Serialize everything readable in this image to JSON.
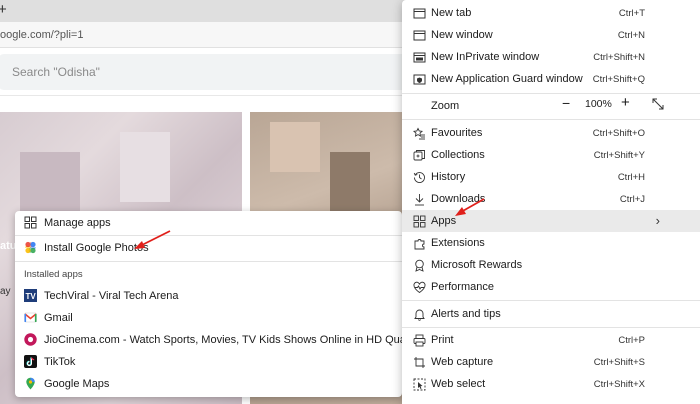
{
  "browser": {
    "new_tab_glyph": "+",
    "url": "oogle.com/?pli=1",
    "more_label": "···"
  },
  "page": {
    "search_placeholder": "Search \"Odisha\"",
    "bg_text_1": "atu",
    "bg_text_2": "ay"
  },
  "apps_submenu": {
    "manage_apps": "Manage apps",
    "install_app": "Install Google Photos",
    "installed_heading": "Installed apps",
    "installed": [
      {
        "label": "TechViral - Viral Tech Arena",
        "icon": "techviral-icon"
      },
      {
        "label": "Gmail",
        "icon": "gmail-icon"
      },
      {
        "label": "JioCinema.com - Watch Sports, Movies, TV  Kids Shows Online in HD Quality",
        "icon": "jiocinema-icon"
      },
      {
        "label": "TikTok",
        "icon": "tiktok-icon"
      },
      {
        "label": "Google Maps",
        "icon": "google-maps-icon"
      }
    ]
  },
  "menu": {
    "new_tab": {
      "label": "New tab",
      "shortcut": "Ctrl+T"
    },
    "new_window": {
      "label": "New window",
      "shortcut": "Ctrl+N"
    },
    "new_inprivate": {
      "label": "New InPrivate window",
      "shortcut": "Ctrl+Shift+N"
    },
    "new_app_guard": {
      "label": "New Application Guard window",
      "shortcut": "Ctrl+Shift+Q"
    },
    "zoom": {
      "label": "Zoom",
      "minus": "−",
      "value": "100%",
      "plus": "+"
    },
    "favourites": {
      "label": "Favourites",
      "shortcut": "Ctrl+Shift+O"
    },
    "collections": {
      "label": "Collections",
      "shortcut": "Ctrl+Shift+Y"
    },
    "history": {
      "label": "History",
      "shortcut": "Ctrl+H"
    },
    "downloads": {
      "label": "Downloads",
      "shortcut": "Ctrl+J"
    },
    "apps": {
      "label": "Apps",
      "chevron": "›"
    },
    "extensions": {
      "label": "Extensions"
    },
    "microsoft_rewards": {
      "label": "Microsoft Rewards"
    },
    "performance": {
      "label": "Performance"
    },
    "alerts_tips": {
      "label": "Alerts and tips"
    },
    "print": {
      "label": "Print",
      "shortcut": "Ctrl+P"
    },
    "web_capture": {
      "label": "Web capture",
      "shortcut": "Ctrl+Shift+S"
    },
    "web_select": {
      "label": "Web select",
      "shortcut": "Ctrl+Shift+X"
    }
  },
  "colors": {
    "annotation_arrow": "#e0201b",
    "highlight": "#eaeaea"
  }
}
